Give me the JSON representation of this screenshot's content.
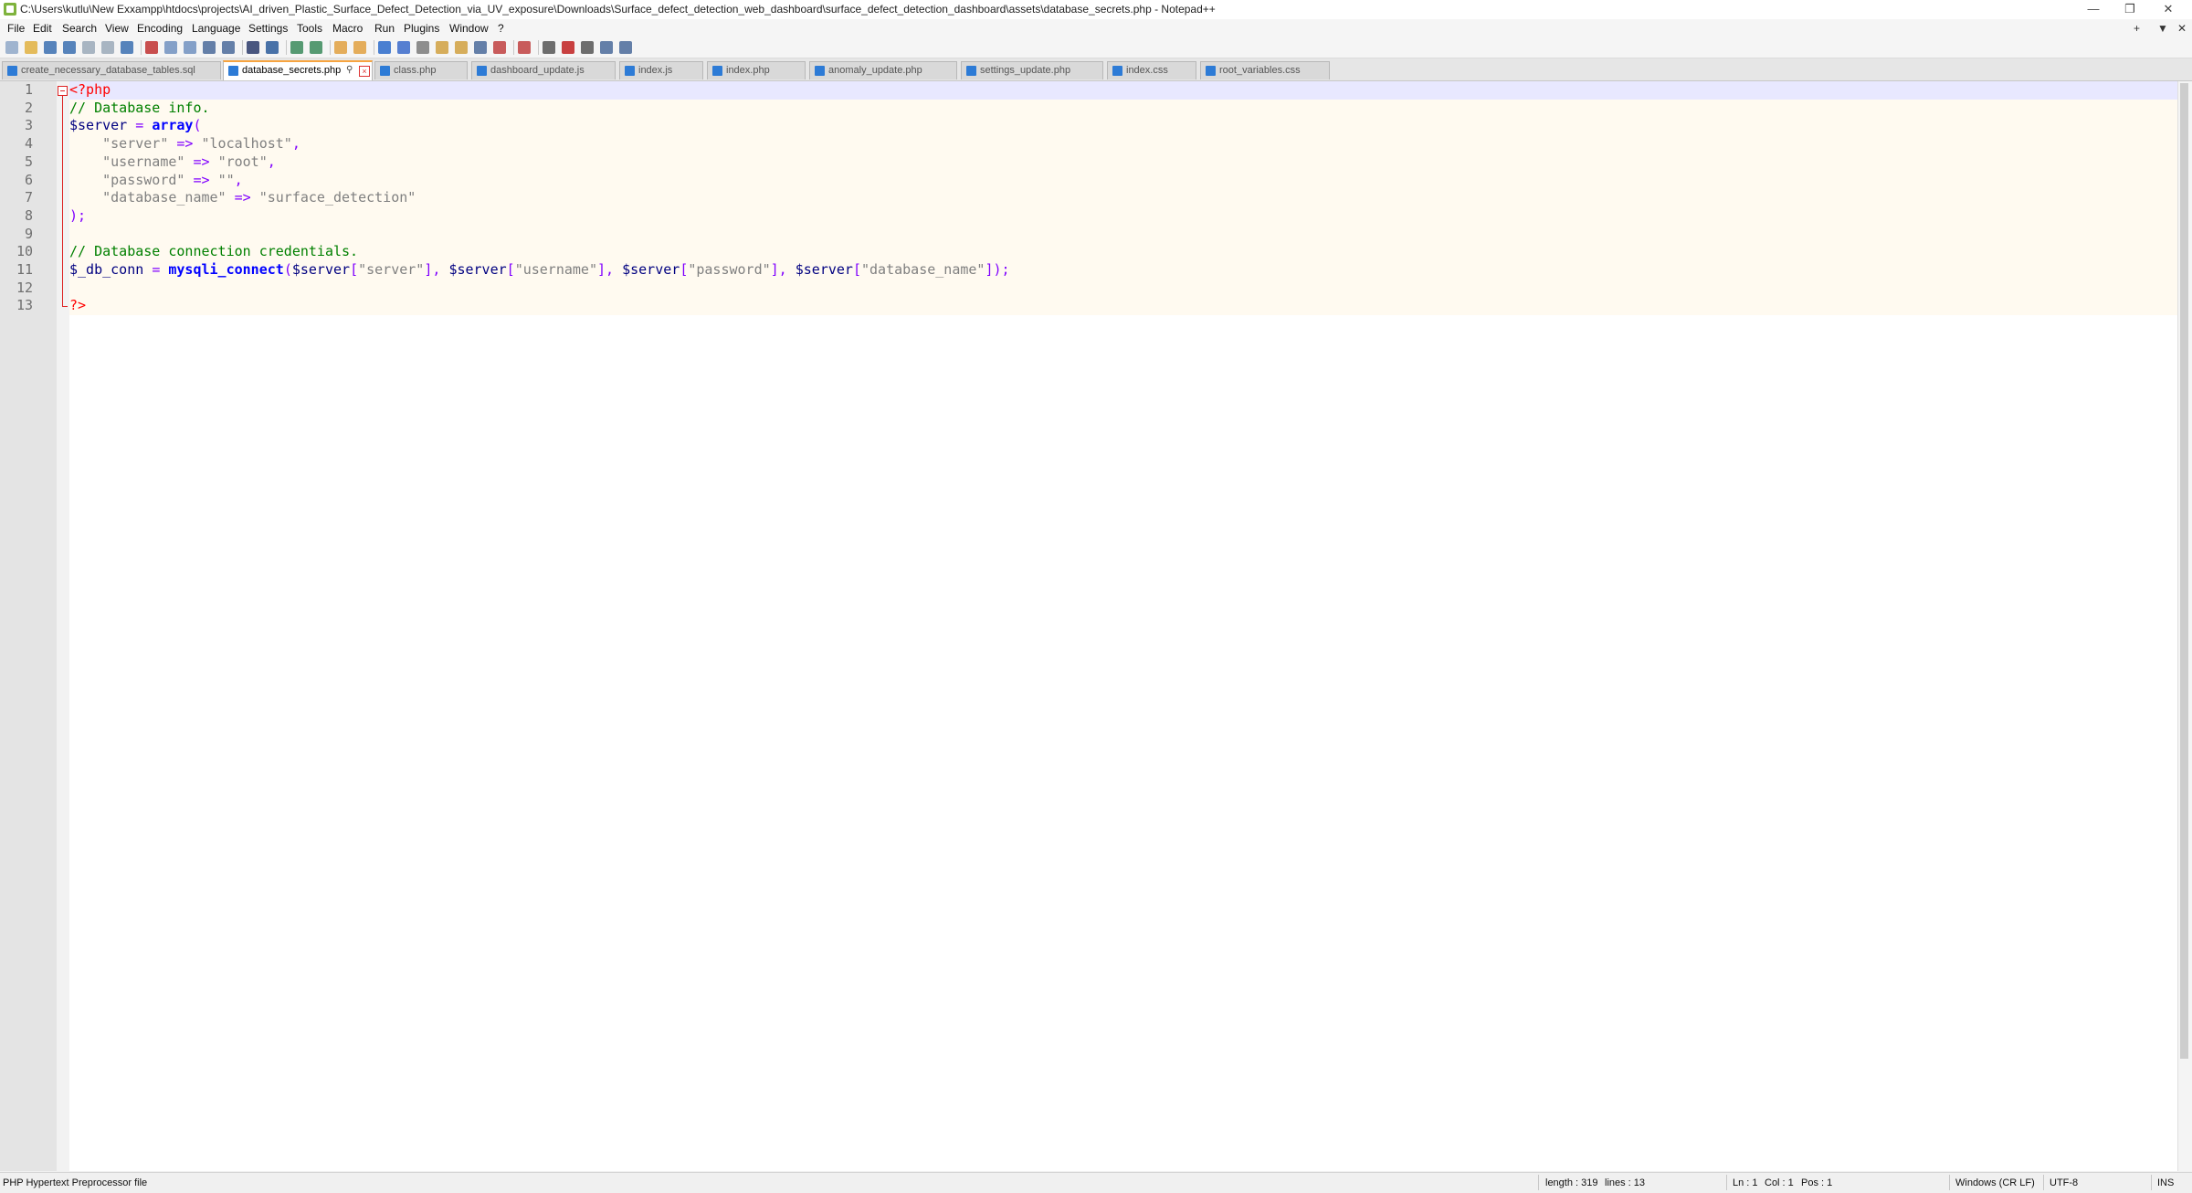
{
  "window": {
    "title": "C:\\Users\\kutlu\\New Exxampp\\htdocs\\projects\\AI_driven_Plastic_Surface_Defect_Detection_via_UV_exposure\\Downloads\\Surface_defect_detection_web_dashboard\\surface_defect_detection_dashboard\\assets\\database_secrets.php - Notepad++",
    "minimize": "—",
    "restore": "❐",
    "close": "✕"
  },
  "menu": {
    "items": [
      "File",
      "Edit",
      "Search",
      "View",
      "Encoding",
      "Language",
      "Settings",
      "Tools",
      "Macro",
      "Run",
      "Plugins",
      "Window",
      "?"
    ],
    "right": [
      "+",
      "▼",
      "✕"
    ]
  },
  "toolbar": {
    "icons": [
      "new-file-icon",
      "open-file-icon",
      "save-icon",
      "save-all-icon",
      "close-icon",
      "close-all-icon",
      "print-icon",
      "cut-icon",
      "copy-icon",
      "paste-icon",
      "undo-icon",
      "redo-icon",
      "find-icon",
      "replace-icon",
      "zoom-in-icon",
      "zoom-out-icon",
      "sync-vertical-icon",
      "sync-horizontal-icon",
      "word-wrap-icon",
      "show-all-chars-icon",
      "indent-guide-icon",
      "doc-map-icon",
      "function-list-icon",
      "folder-workspace-icon",
      "doc-list-icon",
      "monitoring-icon",
      "record-macro-icon",
      "stop-record-icon",
      "play-macro-icon",
      "run-multiple-icon",
      "save-macro-icon"
    ],
    "accent": "#2d7bd6"
  },
  "tabs": [
    {
      "label": "create_necessary_database_tables.sql",
      "active": false
    },
    {
      "label": "database_secrets.php",
      "active": true
    },
    {
      "label": "class.php",
      "active": false
    },
    {
      "label": "dashboard_update.js",
      "active": false
    },
    {
      "label": "index.js",
      "active": false
    },
    {
      "label": "index.php",
      "active": false
    },
    {
      "label": "anomaly_update.php",
      "active": false
    },
    {
      "label": "settings_update.php",
      "active": false
    },
    {
      "label": "index.css",
      "active": false
    },
    {
      "label": "root_variables.css",
      "active": false
    }
  ],
  "editor": {
    "lines": [
      {
        "n": "1",
        "tokens": [
          [
            "<?php",
            "phptag"
          ]
        ]
      },
      {
        "n": "2",
        "tokens": [
          [
            "// Database info.",
            "comment"
          ]
        ]
      },
      {
        "n": "3",
        "tokens": [
          [
            "$server",
            "var"
          ],
          [
            " ",
            "default"
          ],
          [
            "=",
            "op"
          ],
          [
            " ",
            "default"
          ],
          [
            "array",
            "kw"
          ],
          [
            "(",
            "op"
          ]
        ]
      },
      {
        "n": "4",
        "tokens": [
          [
            "    \"server\"",
            "str"
          ],
          [
            " ",
            "default"
          ],
          [
            "=>",
            "op"
          ],
          [
            " ",
            "default"
          ],
          [
            "\"localhost\"",
            "str"
          ],
          [
            ",",
            "op"
          ]
        ]
      },
      {
        "n": "5",
        "tokens": [
          [
            "    \"username\"",
            "str"
          ],
          [
            " ",
            "default"
          ],
          [
            "=>",
            "op"
          ],
          [
            " ",
            "default"
          ],
          [
            "\"root\"",
            "str"
          ],
          [
            ",",
            "op"
          ]
        ]
      },
      {
        "n": "6",
        "tokens": [
          [
            "    \"password\"",
            "str"
          ],
          [
            " ",
            "default"
          ],
          [
            "=>",
            "op"
          ],
          [
            " ",
            "default"
          ],
          [
            "\"\"",
            "str"
          ],
          [
            ",",
            "op"
          ]
        ]
      },
      {
        "n": "7",
        "tokens": [
          [
            "    \"database_name\"",
            "str"
          ],
          [
            " ",
            "default"
          ],
          [
            "=>",
            "op"
          ],
          [
            " ",
            "default"
          ],
          [
            "\"surface_detection\"",
            "str"
          ]
        ]
      },
      {
        "n": "8",
        "tokens": [
          [
            ");",
            "op"
          ]
        ]
      },
      {
        "n": "9",
        "tokens": []
      },
      {
        "n": "10",
        "tokens": [
          [
            "// Database connection credentials.",
            "comment"
          ]
        ]
      },
      {
        "n": "11",
        "tokens": [
          [
            "$_db_conn",
            "var"
          ],
          [
            " ",
            "default"
          ],
          [
            "=",
            "op"
          ],
          [
            " ",
            "default"
          ],
          [
            "mysqli_connect",
            "kw"
          ],
          [
            "(",
            "op"
          ],
          [
            "$server",
            "var"
          ],
          [
            "[",
            "op"
          ],
          [
            "\"server\"",
            "str"
          ],
          [
            "],",
            "op"
          ],
          [
            " ",
            "default"
          ],
          [
            "$server",
            "var"
          ],
          [
            "[",
            "op"
          ],
          [
            "\"username\"",
            "str"
          ],
          [
            "],",
            "op"
          ],
          [
            " ",
            "default"
          ],
          [
            "$server",
            "var"
          ],
          [
            "[",
            "op"
          ],
          [
            "\"password\"",
            "str"
          ],
          [
            "],",
            "op"
          ],
          [
            " ",
            "default"
          ],
          [
            "$server",
            "var"
          ],
          [
            "[",
            "op"
          ],
          [
            "\"database_name\"",
            "str"
          ],
          [
            "]);",
            "op"
          ]
        ]
      },
      {
        "n": "12",
        "tokens": []
      },
      {
        "n": "13",
        "tokens": [
          [
            "?>",
            "phptag"
          ]
        ]
      }
    ]
  },
  "status": {
    "file_type": "PHP Hypertext Preprocessor file",
    "length": "length : 319",
    "lines": "lines : 13",
    "ln": "Ln : 1",
    "col": "Col : 1",
    "pos": "Pos : 1",
    "eol": "Windows (CR LF)",
    "encoding": "UTF-8",
    "mode": "INS"
  }
}
